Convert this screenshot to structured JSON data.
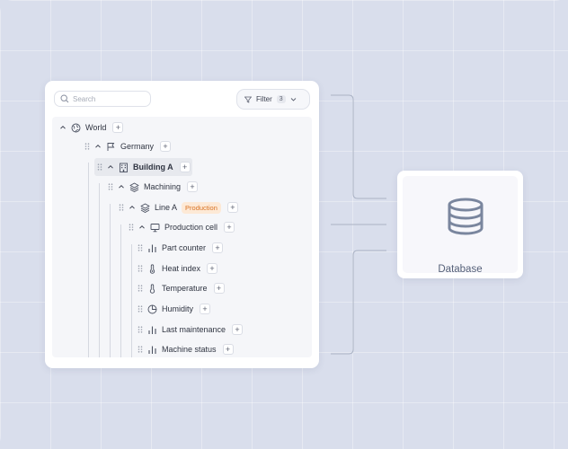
{
  "search": {
    "placeholder": "Search"
  },
  "filter": {
    "label": "Filter",
    "count": "3"
  },
  "tree": {
    "nodes": [
      {
        "label": "World"
      },
      {
        "label": "Germany"
      },
      {
        "label": "Building A"
      },
      {
        "label": "Machining"
      },
      {
        "label": "Line A",
        "badge": "Production"
      },
      {
        "label": "Production cell"
      },
      {
        "label": "Part counter"
      },
      {
        "label": "Heat index"
      },
      {
        "label": "Temperature"
      },
      {
        "label": "Humidity"
      },
      {
        "label": "Last maintenance"
      },
      {
        "label": "Machine status"
      }
    ]
  },
  "database": {
    "label": "Database",
    "icon": "database-icon"
  },
  "colors": {
    "accent_badge_bg": "#fde9d6",
    "accent_badge_text": "#d97324",
    "background": "#d9deec"
  }
}
